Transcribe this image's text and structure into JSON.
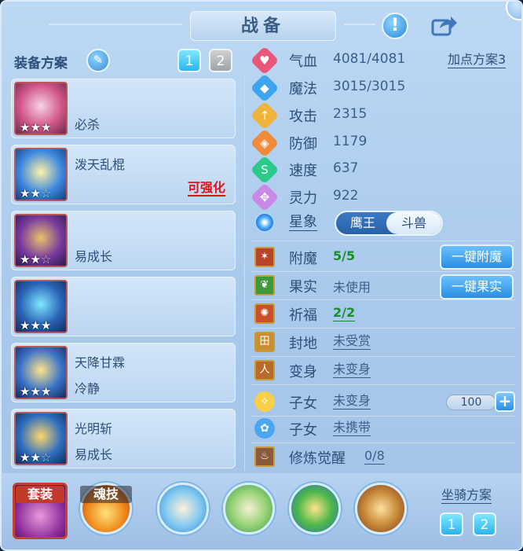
{
  "header": {
    "title": "战备"
  },
  "left": {
    "scheme_label": "装备方案",
    "scheme_buttons": [
      "1",
      "2"
    ],
    "cards": [
      {
        "title": "",
        "subtitle": "必杀",
        "tag": "",
        "stars": 3
      },
      {
        "title": "泼天乱棍",
        "subtitle": "",
        "tag": "可强化",
        "stars": 2
      },
      {
        "title": "",
        "subtitle": "易成长",
        "tag": "",
        "stars": 2
      },
      {
        "title": "",
        "subtitle": "",
        "tag": "",
        "stars": 3
      },
      {
        "title": "天降甘霖",
        "subtitle": "冷静",
        "tag": "",
        "stars": 3
      },
      {
        "title": "光明斩",
        "subtitle": "易成长",
        "tag": "",
        "stars": 2
      }
    ]
  },
  "stats": {
    "plan_link": "加点方案3",
    "items": [
      {
        "label": "气血",
        "value": "4081/4081",
        "icon": "heart-icon",
        "color": "#e8567a"
      },
      {
        "label": "魔法",
        "value": "3015/3015",
        "icon": "mana-icon",
        "color": "#3da4ef"
      },
      {
        "label": "攻击",
        "value": "2315",
        "icon": "sword-icon",
        "color": "#f0b33c"
      },
      {
        "label": "防御",
        "value": "1179",
        "icon": "shield-icon",
        "color": "#f08b3c"
      },
      {
        "label": "速度",
        "value": "637",
        "icon": "speed-icon",
        "color": "#2cc98a"
      },
      {
        "label": "灵力",
        "value": "922",
        "icon": "spirit-icon",
        "color": "#c88ae6"
      }
    ]
  },
  "star_sign": {
    "label": "星象",
    "options": [
      "鹰王",
      "斗兽"
    ],
    "selected": "斗兽"
  },
  "rows": [
    {
      "label": "附魔",
      "value": "5/5",
      "style": "g",
      "icon": "enchant-icon"
    },
    {
      "label": "果实",
      "value": "未使用",
      "style": "",
      "icon": "fruit-icon"
    },
    {
      "label": "祈福",
      "value": "2/2",
      "style": "gu",
      "icon": "blessing-icon"
    },
    {
      "label": "封地",
      "value": "未受赏",
      "style": "u",
      "icon": "fief-icon"
    },
    {
      "label": "变身",
      "value": "未变身",
      "style": "u",
      "icon": "transform-icon"
    },
    {
      "label": "子女",
      "value": "未变身",
      "style": "u",
      "icon": "child-icon"
    },
    {
      "label": "子女",
      "value": "未携带",
      "style": "u",
      "icon": "paw-icon"
    },
    {
      "label": "修炼觉醒",
      "value": "0/8",
      "style": "u",
      "icon": "cultivation-icon"
    }
  ],
  "buttons": {
    "enchant_all": "一键附魔",
    "fruit_all": "一键果实"
  },
  "counter": {
    "value": "100",
    "plus": "+"
  },
  "bottom": {
    "set_label": "套装",
    "soul_label": "魂技",
    "mount_label": "坐骑方案",
    "mount_buttons": [
      "1",
      "2"
    ]
  },
  "icons": {
    "help": "!",
    "share": "share-icon",
    "edit": "✎"
  }
}
